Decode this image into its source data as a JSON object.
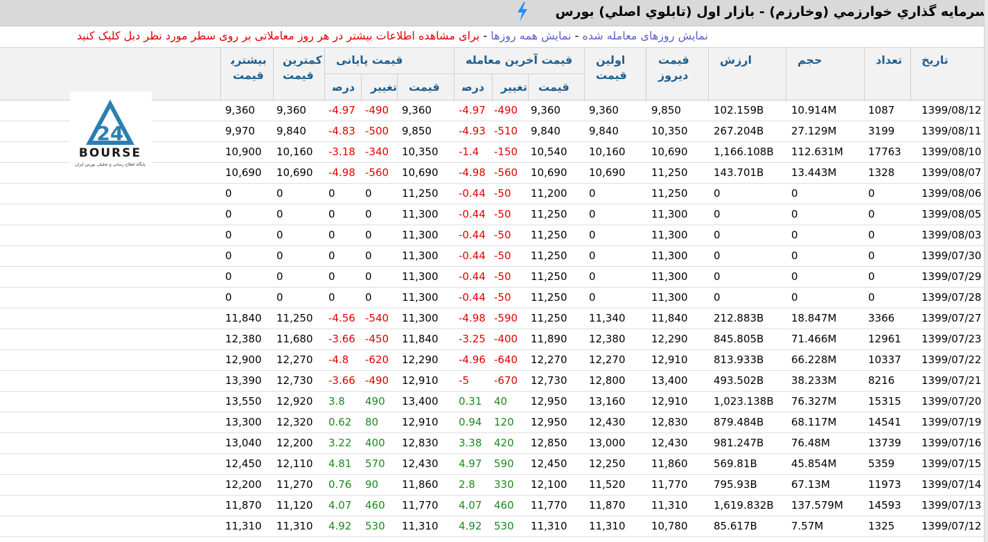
{
  "title": "سرمايه گذاري خوارزمي (وخارزم) - بازار اول (تابلوي اصلي) بورس",
  "links": {
    "all_days": "نمایش همه روزها",
    "sep": " - ",
    "traded_days": "نمایش روزهای معامله شده",
    "instruction": "برای مشاهده اطلاعات بیشتر در هر روز معاملاتی بر روی سطر مورد نظر دبل کلیک کنید"
  },
  "headers": {
    "date": "تاریخ",
    "count": "تعداد",
    "volume": "حجم",
    "value": "ارزش",
    "yesterday_price_1": "قیمت",
    "yesterday_price_2": "دیروز",
    "first_price_1": "اولین",
    "first_price_2": "قیمت",
    "last_trade_group": "قیمت آخرین معامله",
    "closing_group": "قیمت پایانی",
    "sub_price": "قیمت",
    "sub_change": "تغییر",
    "sub_percent": "درصد",
    "min_price_1": "کمترین",
    "min_price_2": "قیمت",
    "max_price_1": "بیشترین",
    "max_price_2": "قیمت"
  },
  "logo": {
    "text": "BOURSE",
    "number": "24",
    "caption": "پایگاه اطلاع رسانی و تحلیلی بورس ایران"
  },
  "rows": [
    {
      "date": "1399/08/12",
      "count": "1087",
      "volume": "10.914M",
      "value": "102.159B",
      "yday": "9,850",
      "first": "9,360",
      "lp": "9,360",
      "lc": "-490",
      "lpct": "-4.97",
      "cp": "9,360",
      "cc": "-490",
      "cpct": "-4.97",
      "min": "9,360",
      "max": "9,360"
    },
    {
      "date": "1399/08/11",
      "count": "3199",
      "volume": "27.129M",
      "value": "267.204B",
      "yday": "10,350",
      "first": "9,840",
      "lp": "9,840",
      "lc": "-510",
      "lpct": "-4.93",
      "cp": "9,850",
      "cc": "-500",
      "cpct": "-4.83",
      "min": "9,840",
      "max": "9,970"
    },
    {
      "date": "1399/08/10",
      "count": "17763",
      "volume": "112.631M",
      "value": "1,166.108B",
      "yday": "10,690",
      "first": "10,160",
      "lp": "10,540",
      "lc": "-150",
      "lpct": "-1.4",
      "cp": "10,350",
      "cc": "-340",
      "cpct": "-3.18",
      "min": "10,160",
      "max": "10,900"
    },
    {
      "date": "1399/08/07",
      "count": "1328",
      "volume": "13.443M",
      "value": "143.701B",
      "yday": "11,250",
      "first": "10,690",
      "lp": "10,690",
      "lc": "-560",
      "lpct": "-4.98",
      "cp": "10,690",
      "cc": "-560",
      "cpct": "-4.98",
      "min": "10,690",
      "max": "10,690"
    },
    {
      "date": "1399/08/06",
      "count": "0",
      "volume": "0",
      "value": "0",
      "yday": "11,250",
      "first": "0",
      "lp": "11,200",
      "lc": "-50",
      "lpct": "-0.44",
      "cp": "11,250",
      "cc": "0",
      "cpct": "0",
      "min": "0",
      "max": "0"
    },
    {
      "date": "1399/08/05",
      "count": "0",
      "volume": "0",
      "value": "0",
      "yday": "11,300",
      "first": "0",
      "lp": "11,250",
      "lc": "-50",
      "lpct": "-0.44",
      "cp": "11,300",
      "cc": "0",
      "cpct": "0",
      "min": "0",
      "max": "0"
    },
    {
      "date": "1399/08/03",
      "count": "0",
      "volume": "0",
      "value": "0",
      "yday": "11,300",
      "first": "0",
      "lp": "11,250",
      "lc": "-50",
      "lpct": "-0.44",
      "cp": "11,300",
      "cc": "0",
      "cpct": "0",
      "min": "0",
      "max": "0"
    },
    {
      "date": "1399/07/30",
      "count": "0",
      "volume": "0",
      "value": "0",
      "yday": "11,300",
      "first": "0",
      "lp": "11,250",
      "lc": "-50",
      "lpct": "-0.44",
      "cp": "11,300",
      "cc": "0",
      "cpct": "0",
      "min": "0",
      "max": "0"
    },
    {
      "date": "1399/07/29",
      "count": "0",
      "volume": "0",
      "value": "0",
      "yday": "11,300",
      "first": "0",
      "lp": "11,250",
      "lc": "-50",
      "lpct": "-0.44",
      "cp": "11,300",
      "cc": "0",
      "cpct": "0",
      "min": "0",
      "max": "0"
    },
    {
      "date": "1399/07/28",
      "count": "0",
      "volume": "0",
      "value": "0",
      "yday": "11,300",
      "first": "0",
      "lp": "11,250",
      "lc": "-50",
      "lpct": "-0.44",
      "cp": "11,300",
      "cc": "0",
      "cpct": "0",
      "min": "0",
      "max": "0"
    },
    {
      "date": "1399/07/27",
      "count": "3366",
      "volume": "18.847M",
      "value": "212.883B",
      "yday": "11,840",
      "first": "11,340",
      "lp": "11,250",
      "lc": "-590",
      "lpct": "-4.98",
      "cp": "11,300",
      "cc": "-540",
      "cpct": "-4.56",
      "min": "11,250",
      "max": "11,840"
    },
    {
      "date": "1399/07/23",
      "count": "12961",
      "volume": "71.466M",
      "value": "845.805B",
      "yday": "12,290",
      "first": "12,380",
      "lp": "11,890",
      "lc": "-400",
      "lpct": "-3.25",
      "cp": "11,840",
      "cc": "-450",
      "cpct": "-3.66",
      "min": "11,680",
      "max": "12,380"
    },
    {
      "date": "1399/07/22",
      "count": "10337",
      "volume": "66.228M",
      "value": "813.933B",
      "yday": "12,910",
      "first": "12,270",
      "lp": "12,270",
      "lc": "-640",
      "lpct": "-4.96",
      "cp": "12,290",
      "cc": "-620",
      "cpct": "-4.8",
      "min": "12,270",
      "max": "12,900"
    },
    {
      "date": "1399/07/21",
      "count": "8216",
      "volume": "38.233M",
      "value": "493.502B",
      "yday": "13,400",
      "first": "12,800",
      "lp": "12,730",
      "lc": "-670",
      "lpct": "-5",
      "cp": "12,910",
      "cc": "-490",
      "cpct": "-3.66",
      "min": "12,730",
      "max": "13,390"
    },
    {
      "date": "1399/07/20",
      "count": "15315",
      "volume": "76.327M",
      "value": "1,023.138B",
      "yday": "12,910",
      "first": "13,160",
      "lp": "12,950",
      "lc": "40",
      "lpct": "0.31",
      "cp": "13,400",
      "cc": "490",
      "cpct": "3.8",
      "min": "12,920",
      "max": "13,550"
    },
    {
      "date": "1399/07/19",
      "count": "14541",
      "volume": "68.117M",
      "value": "879.484B",
      "yday": "12,830",
      "first": "12,430",
      "lp": "12,950",
      "lc": "120",
      "lpct": "0.94",
      "cp": "12,910",
      "cc": "80",
      "cpct": "0.62",
      "min": "12,320",
      "max": "13,300"
    },
    {
      "date": "1399/07/16",
      "count": "13739",
      "volume": "76.48M",
      "value": "981.247B",
      "yday": "12,430",
      "first": "13,000",
      "lp": "12,850",
      "lc": "420",
      "lpct": "3.38",
      "cp": "12,830",
      "cc": "400",
      "cpct": "3.22",
      "min": "12,200",
      "max": "13,040"
    },
    {
      "date": "1399/07/15",
      "count": "5359",
      "volume": "45.854M",
      "value": "569.81B",
      "yday": "11,860",
      "first": "12,250",
      "lp": "12,450",
      "lc": "590",
      "lpct": "4.97",
      "cp": "12,430",
      "cc": "570",
      "cpct": "4.81",
      "min": "12,110",
      "max": "12,450"
    },
    {
      "date": "1399/07/14",
      "count": "11973",
      "volume": "67.13M",
      "value": "795.93B",
      "yday": "11,770",
      "first": "11,520",
      "lp": "12,100",
      "lc": "330",
      "lpct": "2.8",
      "cp": "11,860",
      "cc": "90",
      "cpct": "0.76",
      "min": "11,270",
      "max": "12,200"
    },
    {
      "date": "1399/07/13",
      "count": "14593",
      "volume": "137.579M",
      "value": "1,619.832B",
      "yday": "11,310",
      "first": "11,870",
      "lp": "11,770",
      "lc": "460",
      "lpct": "4.07",
      "cp": "11,770",
      "cc": "460",
      "cpct": "4.07",
      "min": "11,120",
      "max": "11,870"
    },
    {
      "date": "1399/07/12",
      "count": "1325",
      "volume": "7.57M",
      "value": "85.617B",
      "yday": "10,780",
      "first": "11,310",
      "lp": "11,310",
      "lc": "530",
      "lpct": "4.92",
      "cp": "11,310",
      "cc": "530",
      "cpct": "4.92",
      "min": "11,310",
      "max": "11,310"
    }
  ]
}
